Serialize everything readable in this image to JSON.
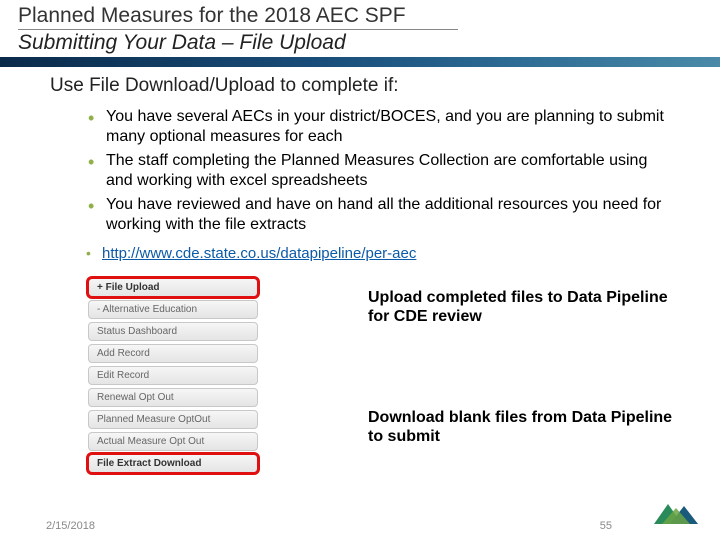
{
  "header": {
    "title1": "Planned Measures for the 2018 AEC SPF",
    "title2": "Submitting Your Data – File Upload"
  },
  "lead": "Use File Download/Upload to complete if:",
  "bullets": [
    "You have several AECs in your district/BOCES, and you are planning to submit many optional measures for each",
    "The staff completing the Planned Measures Collection are comfortable using and working with excel spreadsheets",
    "You have reviewed and have on hand all the additional resources you need for working with the file extracts"
  ],
  "link": "http://www.cde.state.co.us/datapipeline/per-aec",
  "menu": [
    {
      "label": "+ File Upload",
      "hl": true
    },
    {
      "label": "- Alternative Education",
      "hl": false
    },
    {
      "label": "Status Dashboard",
      "hl": false
    },
    {
      "label": "Add Record",
      "hl": false
    },
    {
      "label": "Edit Record",
      "hl": false
    },
    {
      "label": "Renewal Opt Out",
      "hl": false
    },
    {
      "label": "Planned Measure OptOut",
      "hl": false
    },
    {
      "label": "Actual Measure Opt Out",
      "hl": false
    },
    {
      "label": "File Extract Download",
      "hl": true
    }
  ],
  "callout1": "Upload completed files to Data Pipeline for CDE review",
  "callout2": "Download blank files from Data Pipeline to submit",
  "footer": {
    "date": "2/15/2018",
    "page": "55"
  }
}
